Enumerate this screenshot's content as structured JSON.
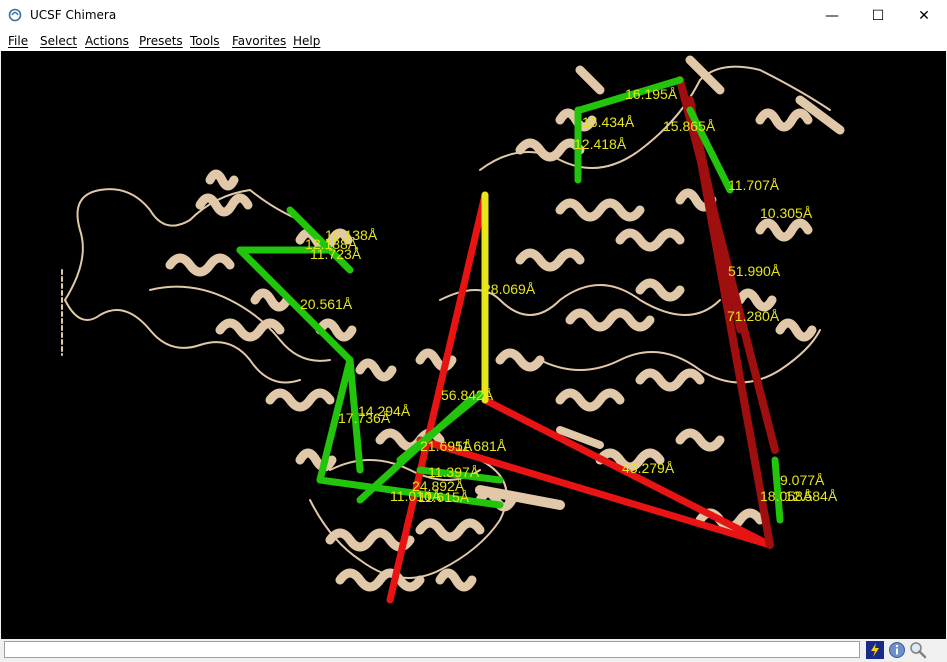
{
  "window": {
    "title": "UCSF Chimera",
    "controls": {
      "minimize": "—",
      "maximize": "☐",
      "close": "✕"
    }
  },
  "menu": [
    "File",
    "Select",
    "Actions",
    "Presets",
    "Tools",
    "Favorites",
    "Help"
  ],
  "viewer": {
    "background": "#000000",
    "ribbon_color": "#e0c8a8",
    "link_colors": {
      "green": "#22c40c",
      "red": "#e81313",
      "dark_red": "#a00f0f",
      "yellow": "#e6e619"
    },
    "distance_labels": [
      "16.195Å",
      "16.434Å",
      "15.865Å",
      "12.418Å",
      "11.707Å",
      "10.305Å",
      "10.138Å",
      "12.188Å",
      "11.723Å",
      "28.069Å",
      "20.561Å",
      "51.990Å",
      "71.280Å",
      "56.842Å",
      "17.736Å",
      "14.294Å",
      "21.695Å",
      "11.681Å",
      "11.397Å",
      "24.892Å",
      "11.010Å",
      "11.615Å",
      "43.279Å",
      "9.077Å",
      "18.058Å",
      "12.584Å"
    ]
  },
  "statusbar": {
    "message": ""
  }
}
